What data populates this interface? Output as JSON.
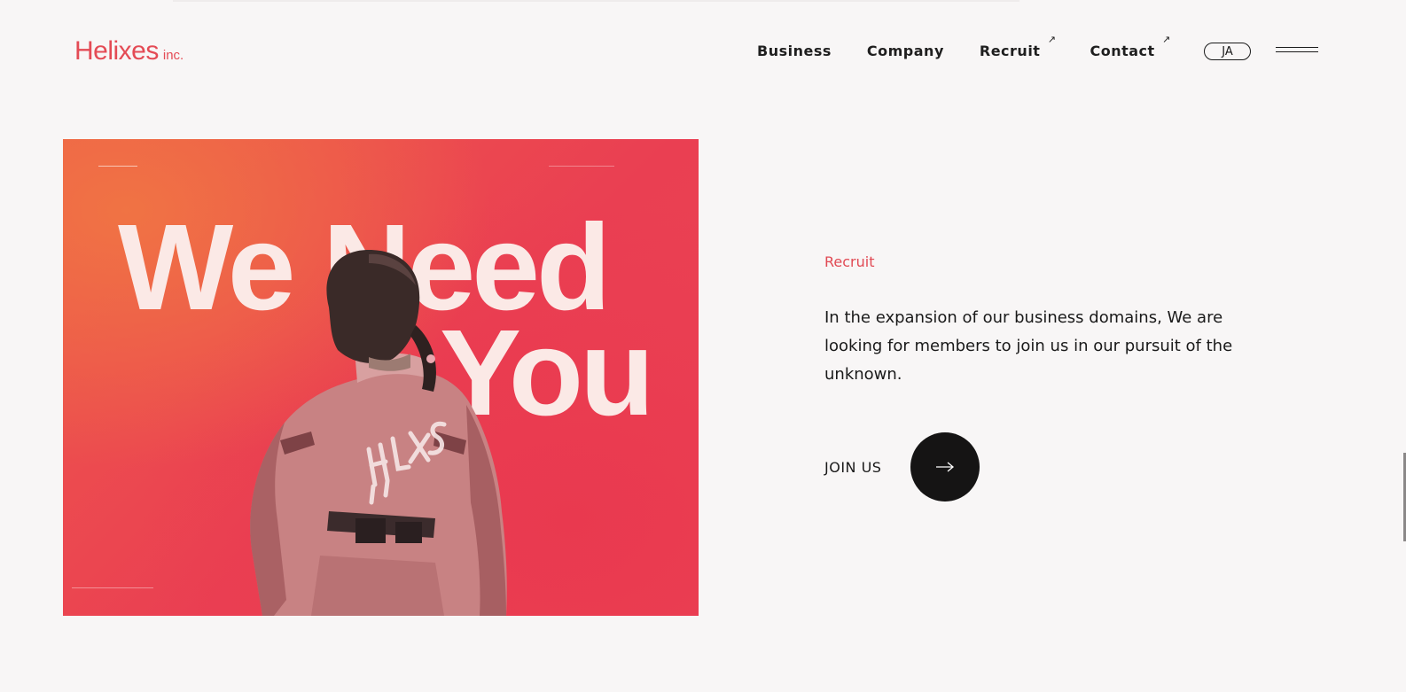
{
  "brand": {
    "name": "Helixes",
    "suffix": "inc.",
    "color": "#e44b55"
  },
  "nav": {
    "items": [
      {
        "label": "Business",
        "external": false
      },
      {
        "label": "Company",
        "external": false
      },
      {
        "label": "Recruit",
        "external": true
      },
      {
        "label": "Contact",
        "external": true
      }
    ],
    "external_icon": "↗",
    "lang_label": "JA",
    "menu_icon": "hamburger-icon"
  },
  "hero": {
    "line1": "We Need",
    "line2": "You",
    "jacket_tag": "HLXS"
  },
  "recruit": {
    "eyebrow": "Recruit",
    "description": "In the expansion of our business domains, We are looking for members to join us in our pursuit of the unknown.",
    "cta_label": "JOIN US",
    "cta_icon": "arrow-right-icon"
  },
  "colors": {
    "accent": "#e14a54",
    "background": "#f8f6f6",
    "cta_bg": "#151414"
  }
}
